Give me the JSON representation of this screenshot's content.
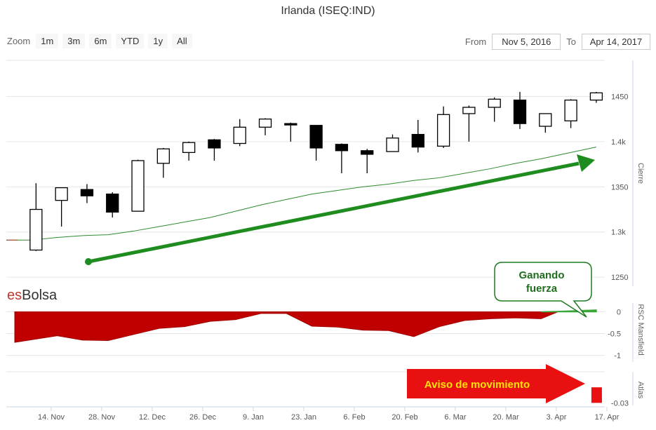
{
  "title": "Irlanda (ISEQ:IND)",
  "toolbar": {
    "zoom_label": "Zoom",
    "buttons": [
      "1m",
      "3m",
      "6m",
      "YTD",
      "1y",
      "All"
    ],
    "from_label": "From",
    "from_value": "Nov 5, 2016",
    "to_label": "To",
    "to_value": "Apr 14, 2017"
  },
  "brand": {
    "es": "es",
    "bolsa": "Bolsa"
  },
  "colors": {
    "up_fill": "#ffffff",
    "down_fill": "#000000",
    "ma_line": "#2e8b2e",
    "arrow": "#1e8c1e",
    "rsc_neg": "#c00000",
    "rsc_pos": "#3aa63a",
    "warning": "#e81010"
  },
  "annotations": {
    "callout": "Ganando fuerza",
    "warning": "Aviso de movimiento"
  },
  "chart_data": [
    {
      "type": "candlestick",
      "pane": "Cierre",
      "axis_title": "Cierre",
      "y_ticks": [
        "1450",
        "1.4k",
        "1350",
        "1.3k",
        "1250"
      ],
      "x_ticks": [
        "14. Nov",
        "28. Nov",
        "12. Dec",
        "26. Dec",
        "9. Jan",
        "23. Jan",
        "6. Feb",
        "20. Feb",
        "6. Mar",
        "20. Mar",
        "3. Apr",
        "17. Apr"
      ],
      "ylim": [
        1240,
        1490
      ],
      "candles": [
        {
          "t": 7,
          "o": 1280,
          "h": 1354,
          "l": 1279,
          "c": 1325
        },
        {
          "t": 13,
          "o": 1335,
          "h": 1349,
          "l": 1306,
          "c": 1349
        },
        {
          "t": 19,
          "o": 1347,
          "h": 1353,
          "l": 1332,
          "c": 1340
        },
        {
          "t": 25,
          "o": 1342,
          "h": 1344,
          "l": 1316,
          "c": 1322
        },
        {
          "t": 31,
          "o": 1323,
          "h": 1380,
          "l": 1323,
          "c": 1379
        },
        {
          "t": 37,
          "o": 1376,
          "h": 1393,
          "l": 1360,
          "c": 1392
        },
        {
          "t": 43,
          "o": 1388,
          "h": 1400,
          "l": 1379,
          "c": 1399
        },
        {
          "t": 49,
          "o": 1402,
          "h": 1403,
          "l": 1379,
          "c": 1393
        },
        {
          "t": 55,
          "o": 1398,
          "h": 1425,
          "l": 1395,
          "c": 1416
        },
        {
          "t": 61,
          "o": 1416,
          "h": 1426,
          "l": 1407,
          "c": 1425
        },
        {
          "t": 67,
          "o": 1420,
          "h": 1421,
          "l": 1400,
          "c": 1419
        },
        {
          "t": 73,
          "o": 1418,
          "h": 1418,
          "l": 1379,
          "c": 1393
        },
        {
          "t": 79,
          "o": 1397,
          "h": 1398,
          "l": 1365,
          "c": 1390
        },
        {
          "t": 85,
          "o": 1390,
          "h": 1392,
          "l": 1365,
          "c": 1386
        },
        {
          "t": 91,
          "o": 1389,
          "h": 1408,
          "l": 1389,
          "c": 1404
        },
        {
          "t": 97,
          "o": 1408,
          "h": 1424,
          "l": 1388,
          "c": 1394
        },
        {
          "t": 103,
          "o": 1395,
          "h": 1439,
          "l": 1393,
          "c": 1430
        },
        {
          "t": 109,
          "o": 1431,
          "h": 1440,
          "l": 1400,
          "c": 1438
        },
        {
          "t": 115,
          "o": 1438,
          "h": 1449,
          "l": 1422,
          "c": 1447
        },
        {
          "t": 121,
          "o": 1446,
          "h": 1455,
          "l": 1414,
          "c": 1420
        },
        {
          "t": 127,
          "o": 1417,
          "h": 1431,
          "l": 1410,
          "c": 1431
        },
        {
          "t": 133,
          "o": 1423,
          "h": 1447,
          "l": 1415,
          "c": 1446
        },
        {
          "t": 139,
          "o": 1446,
          "h": 1455,
          "l": 1443,
          "c": 1454
        }
      ],
      "moving_average": {
        "t": [
          0,
          6,
          12,
          18,
          24,
          30,
          36,
          42,
          48,
          54,
          60,
          66,
          72,
          78,
          84,
          90,
          96,
          102,
          108,
          114,
          120,
          126,
          132,
          139
        ],
        "values": [
          1291,
          1291,
          1294,
          1296,
          1297,
          1301,
          1306,
          1311,
          1316,
          1323,
          1330,
          1336,
          1342,
          1346,
          1350,
          1353,
          1357,
          1360,
          1365,
          1370,
          1376,
          1381,
          1387,
          1394
        ]
      }
    },
    {
      "type": "area",
      "pane": "RSC Mansfield",
      "axis_title": "RSC Mansfield",
      "y_ticks": [
        "0",
        "-0.5",
        "-1"
      ],
      "ylim": [
        -1.15,
        0.2
      ],
      "t": [
        0,
        12,
        18,
        24,
        30,
        36,
        42,
        48,
        54,
        60,
        66,
        72,
        78,
        84,
        90,
        96,
        102,
        108,
        114,
        120,
        126,
        130,
        139
      ],
      "values": [
        -0.7,
        -0.55,
        -0.65,
        -0.66,
        -0.52,
        -0.38,
        -0.34,
        -0.22,
        -0.18,
        -0.04,
        -0.04,
        -0.33,
        -0.35,
        -0.42,
        -0.43,
        -0.57,
        -0.34,
        -0.2,
        -0.16,
        -0.14,
        -0.16,
        0.01,
        0.04
      ]
    },
    {
      "type": "bar",
      "pane": "Atlas",
      "axis_title": "Atlas",
      "y_ticks": [
        "-0.03"
      ],
      "ylim": [
        -0.035,
        0.03
      ],
      "bars": [
        {
          "t": 139,
          "value": -0.03
        }
      ]
    }
  ]
}
